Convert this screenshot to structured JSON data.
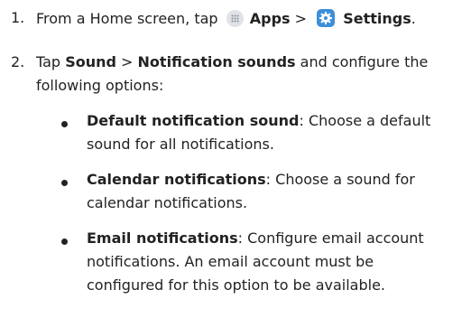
{
  "steps": [
    {
      "number": "1.",
      "prefix": "From a Home screen, tap",
      "apps_label": "Apps",
      "separator": ">",
      "settings_label": "Settings",
      "suffix": ".",
      "icons": [
        "apps-grid-icon",
        "settings-gear-icon"
      ]
    },
    {
      "number": "2.",
      "prefix": "Tap",
      "sound_label": "Sound",
      "separator": ">",
      "notification_label": "Notification sounds",
      "line1_suffix": "and configure the",
      "line2": "following options:"
    }
  ],
  "options": [
    {
      "title": "Default notification sound",
      "line1_rest": ": Choose a default",
      "line2": "sound for all notifications."
    },
    {
      "title": "Calendar notifications",
      "line1_rest": ": Choose a sound for",
      "line2": "calendar notifications."
    },
    {
      "title": "Email notifications",
      "line1_rest": ": Configure email account",
      "line2": "notifications. An email account must be",
      "line3": "configured for this option to be available."
    }
  ],
  "colors": {
    "text": "#222222",
    "settings_icon_bg": "#3d8fd8",
    "apps_icon_bg": "#dfe2e6"
  }
}
